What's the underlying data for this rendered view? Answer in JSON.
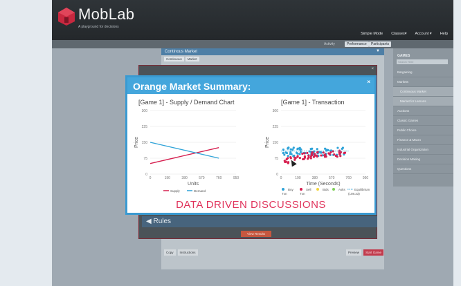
{
  "header": {
    "brand": "MobLab",
    "tagline": "A playground for decisions",
    "nav": [
      "Simple Mode",
      "Classes▾",
      "Account ▾",
      "Help"
    ],
    "activity_label": "Activity",
    "pills": [
      "Performance",
      "Participants"
    ]
  },
  "main": {
    "title": "Continous Market",
    "tabs": [
      "Continuous",
      "Market"
    ],
    "rules_label": "◀ Rules",
    "view_results": "View Results",
    "buttons_left": [
      "Copy",
      "Instructions"
    ],
    "buttons_right": [
      "Preview",
      "Start Game"
    ]
  },
  "sidebar": {
    "title": "GAMES",
    "search_placeholder": "Search Here",
    "items": [
      {
        "label": "Bargaining",
        "sub": false
      },
      {
        "label": "Markets",
        "sub": false
      },
      {
        "label": "Continuous Market",
        "sub": true
      },
      {
        "label": "Market for Lemons",
        "sub": true
      },
      {
        "label": "Auctions",
        "sub": false
      },
      {
        "label": "Classic Games",
        "sub": false
      },
      {
        "label": "Public Choice",
        "sub": false
      },
      {
        "label": "Finance & Macro",
        "sub": false
      },
      {
        "label": "Industrial Organization",
        "sub": false
      },
      {
        "label": "Decision Making",
        "sub": false
      },
      {
        "label": "Questions",
        "sub": false
      }
    ]
  },
  "overlay": {
    "title": "Orange Market Summary:",
    "close": "×",
    "banner": "DATA DRIVEN  DISCUSSIONS"
  },
  "colors": {
    "accent": "#44a6dc",
    "supply": "#d62050",
    "demand": "#2fa3d8",
    "banner": "#e0335b"
  },
  "chart_data": [
    {
      "type": "line",
      "title": "[Game 1] - Supply / Demand Chart",
      "xlabel": "Units",
      "ylabel": "Price",
      "x_ticks": [
        "0",
        "190",
        "380",
        "570",
        "760",
        "950"
      ],
      "y_ticks": [
        "0",
        "75",
        "150",
        "225",
        "300"
      ],
      "xlim": [
        0,
        950
      ],
      "ylim": [
        0,
        300
      ],
      "series": [
        {
          "name": "Supply",
          "color": "#d62050",
          "points": [
            [
              0,
              50
            ],
            [
              760,
              125
            ]
          ]
        },
        {
          "name": "Demand",
          "color": "#2fa3d8",
          "points": [
            [
              0,
              150
            ],
            [
              760,
              75
            ]
          ]
        }
      ]
    },
    {
      "type": "scatter",
      "title": "[Game 1] - Transaction",
      "xlabel": "Time (Seconds)",
      "ylabel": "Price",
      "x_ticks": [
        "0",
        "190",
        "380",
        "570",
        "760",
        "950"
      ],
      "y_ticks": [
        "0",
        "75",
        "150",
        "225",
        "300"
      ],
      "xlim": [
        0,
        950
      ],
      "ylim": [
        0,
        300
      ],
      "legend": [
        {
          "label": "Buy\nTxn",
          "color": "#2fa3d8"
        },
        {
          "label": "Sell\nTxn",
          "color": "#d62050"
        },
        {
          "label": "Bids",
          "color": "#f2d43a"
        },
        {
          "label": "Asks",
          "color": "#7fcf5a"
        },
        {
          "label": "Equilibrium\n(108.33)",
          "color": "#2fa3d8"
        }
      ],
      "equilibrium": 108.33
    }
  ]
}
